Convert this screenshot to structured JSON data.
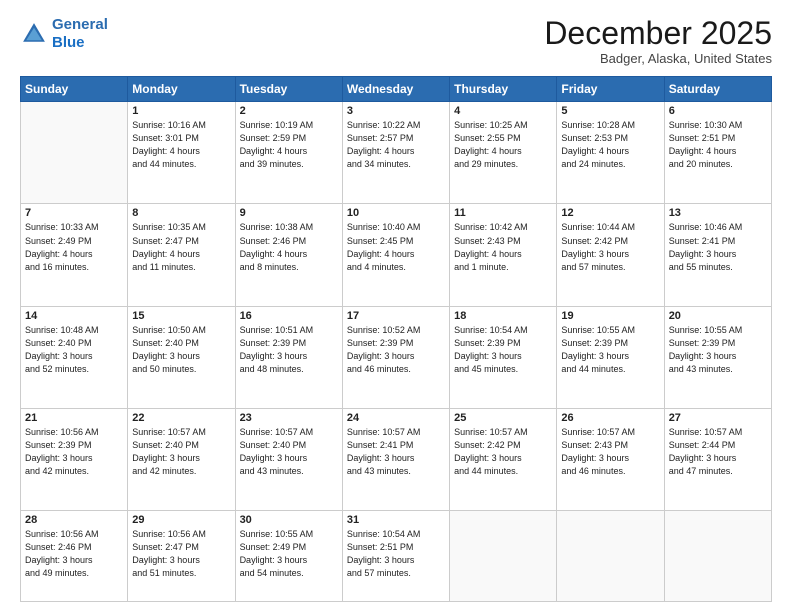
{
  "logo": {
    "line1": "General",
    "line2": "Blue"
  },
  "title": "December 2025",
  "location": "Badger, Alaska, United States",
  "days_of_week": [
    "Sunday",
    "Monday",
    "Tuesday",
    "Wednesday",
    "Thursday",
    "Friday",
    "Saturday"
  ],
  "weeks": [
    [
      {
        "day": "",
        "info": ""
      },
      {
        "day": "1",
        "info": "Sunrise: 10:16 AM\nSunset: 3:01 PM\nDaylight: 4 hours\nand 44 minutes."
      },
      {
        "day": "2",
        "info": "Sunrise: 10:19 AM\nSunset: 2:59 PM\nDaylight: 4 hours\nand 39 minutes."
      },
      {
        "day": "3",
        "info": "Sunrise: 10:22 AM\nSunset: 2:57 PM\nDaylight: 4 hours\nand 34 minutes."
      },
      {
        "day": "4",
        "info": "Sunrise: 10:25 AM\nSunset: 2:55 PM\nDaylight: 4 hours\nand 29 minutes."
      },
      {
        "day": "5",
        "info": "Sunrise: 10:28 AM\nSunset: 2:53 PM\nDaylight: 4 hours\nand 24 minutes."
      },
      {
        "day": "6",
        "info": "Sunrise: 10:30 AM\nSunset: 2:51 PM\nDaylight: 4 hours\nand 20 minutes."
      }
    ],
    [
      {
        "day": "7",
        "info": "Sunrise: 10:33 AM\nSunset: 2:49 PM\nDaylight: 4 hours\nand 16 minutes."
      },
      {
        "day": "8",
        "info": "Sunrise: 10:35 AM\nSunset: 2:47 PM\nDaylight: 4 hours\nand 11 minutes."
      },
      {
        "day": "9",
        "info": "Sunrise: 10:38 AM\nSunset: 2:46 PM\nDaylight: 4 hours\nand 8 minutes."
      },
      {
        "day": "10",
        "info": "Sunrise: 10:40 AM\nSunset: 2:45 PM\nDaylight: 4 hours\nand 4 minutes."
      },
      {
        "day": "11",
        "info": "Sunrise: 10:42 AM\nSunset: 2:43 PM\nDaylight: 4 hours\nand 1 minute."
      },
      {
        "day": "12",
        "info": "Sunrise: 10:44 AM\nSunset: 2:42 PM\nDaylight: 3 hours\nand 57 minutes."
      },
      {
        "day": "13",
        "info": "Sunrise: 10:46 AM\nSunset: 2:41 PM\nDaylight: 3 hours\nand 55 minutes."
      }
    ],
    [
      {
        "day": "14",
        "info": "Sunrise: 10:48 AM\nSunset: 2:40 PM\nDaylight: 3 hours\nand 52 minutes."
      },
      {
        "day": "15",
        "info": "Sunrise: 10:50 AM\nSunset: 2:40 PM\nDaylight: 3 hours\nand 50 minutes."
      },
      {
        "day": "16",
        "info": "Sunrise: 10:51 AM\nSunset: 2:39 PM\nDaylight: 3 hours\nand 48 minutes."
      },
      {
        "day": "17",
        "info": "Sunrise: 10:52 AM\nSunset: 2:39 PM\nDaylight: 3 hours\nand 46 minutes."
      },
      {
        "day": "18",
        "info": "Sunrise: 10:54 AM\nSunset: 2:39 PM\nDaylight: 3 hours\nand 45 minutes."
      },
      {
        "day": "19",
        "info": "Sunrise: 10:55 AM\nSunset: 2:39 PM\nDaylight: 3 hours\nand 44 minutes."
      },
      {
        "day": "20",
        "info": "Sunrise: 10:55 AM\nSunset: 2:39 PM\nDaylight: 3 hours\nand 43 minutes."
      }
    ],
    [
      {
        "day": "21",
        "info": "Sunrise: 10:56 AM\nSunset: 2:39 PM\nDaylight: 3 hours\nand 42 minutes."
      },
      {
        "day": "22",
        "info": "Sunrise: 10:57 AM\nSunset: 2:40 PM\nDaylight: 3 hours\nand 42 minutes."
      },
      {
        "day": "23",
        "info": "Sunrise: 10:57 AM\nSunset: 2:40 PM\nDaylight: 3 hours\nand 43 minutes."
      },
      {
        "day": "24",
        "info": "Sunrise: 10:57 AM\nSunset: 2:41 PM\nDaylight: 3 hours\nand 43 minutes."
      },
      {
        "day": "25",
        "info": "Sunrise: 10:57 AM\nSunset: 2:42 PM\nDaylight: 3 hours\nand 44 minutes."
      },
      {
        "day": "26",
        "info": "Sunrise: 10:57 AM\nSunset: 2:43 PM\nDaylight: 3 hours\nand 46 minutes."
      },
      {
        "day": "27",
        "info": "Sunrise: 10:57 AM\nSunset: 2:44 PM\nDaylight: 3 hours\nand 47 minutes."
      }
    ],
    [
      {
        "day": "28",
        "info": "Sunrise: 10:56 AM\nSunset: 2:46 PM\nDaylight: 3 hours\nand 49 minutes."
      },
      {
        "day": "29",
        "info": "Sunrise: 10:56 AM\nSunset: 2:47 PM\nDaylight: 3 hours\nand 51 minutes."
      },
      {
        "day": "30",
        "info": "Sunrise: 10:55 AM\nSunset: 2:49 PM\nDaylight: 3 hours\nand 54 minutes."
      },
      {
        "day": "31",
        "info": "Sunrise: 10:54 AM\nSunset: 2:51 PM\nDaylight: 3 hours\nand 57 minutes."
      },
      {
        "day": "",
        "info": ""
      },
      {
        "day": "",
        "info": ""
      },
      {
        "day": "",
        "info": ""
      }
    ]
  ]
}
